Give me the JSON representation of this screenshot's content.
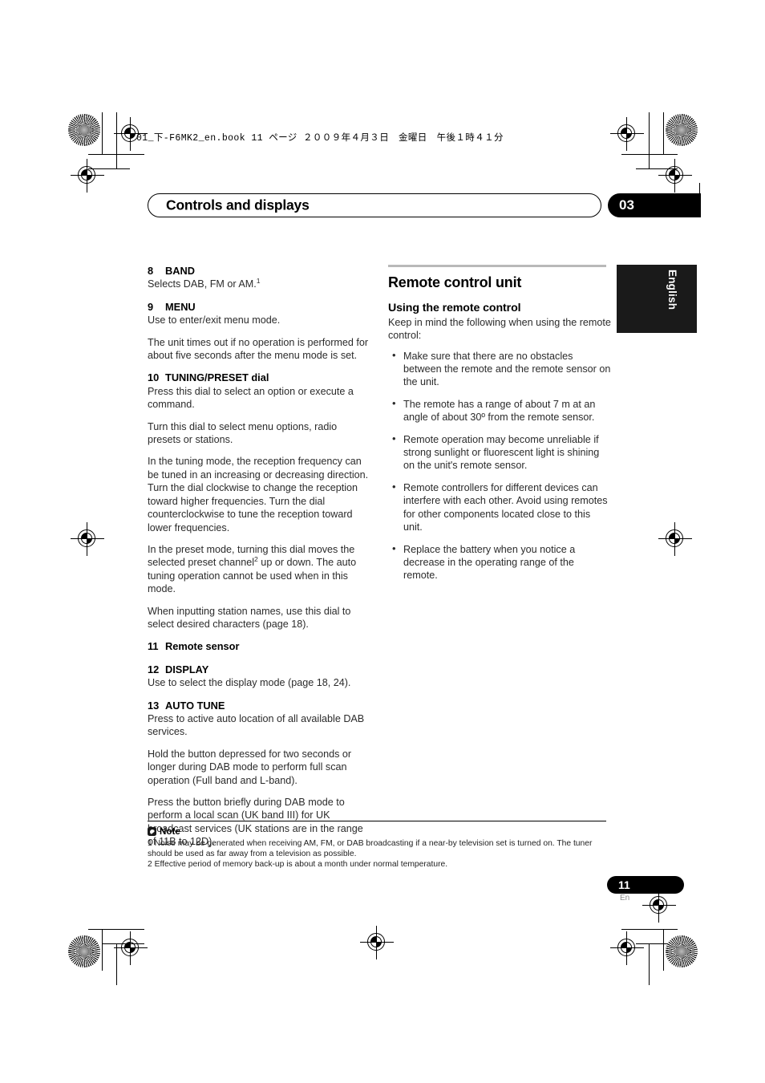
{
  "print_slug": "01_下-F6MK2_en.book  11 ページ  ２００９年４月３日　金曜日　午後１時４１分",
  "header": {
    "chapter_title": "Controls and displays",
    "chapter_number": "03",
    "language_tab": "English"
  },
  "left_column": {
    "entries": [
      {
        "num": "8",
        "title": "BAND",
        "paragraphs": [
          {
            "text": "Selects DAB, FM or AM.",
            "sup": "1"
          }
        ]
      },
      {
        "num": "9",
        "title": "MENU",
        "paragraphs": [
          {
            "text": "Use to enter/exit menu mode."
          },
          {
            "text": "The unit times out if no operation is performed for about five seconds after the menu mode is set."
          }
        ]
      },
      {
        "num": "10",
        "title": "TUNING/PRESET dial",
        "paragraphs": [
          {
            "text": "Press this dial to select an option or execute a command."
          },
          {
            "text": "Turn this dial to select menu options, radio presets or stations."
          },
          {
            "text": "In the tuning mode, the reception frequency can be tuned in an increasing or decreasing direction. Turn the dial clockwise to change the reception toward higher frequencies. Turn the dial counterclockwise to tune the reception toward lower frequencies."
          },
          {
            "text": "In the preset mode, turning this dial moves the selected preset channel",
            "sup": "2",
            "text_after": " up or down. The auto tuning operation cannot be used when in this mode."
          },
          {
            "text": "When inputting station names, use this dial to select desired characters (page 18)."
          }
        ]
      },
      {
        "num": "11",
        "title": "Remote sensor",
        "paragraphs": []
      },
      {
        "num": "12",
        "title": "DISPLAY",
        "paragraphs": [
          {
            "text": "Use to select the display mode (page 18, 24)."
          }
        ]
      },
      {
        "num": "13",
        "title": "AUTO TUNE",
        "paragraphs": [
          {
            "text": "Press to active auto location of all available DAB services."
          },
          {
            "text": "Hold the button depressed for two seconds or longer during DAB mode to perform full scan operation (Full band and L-band)."
          },
          {
            "text": "Press the button briefly during DAB mode to perform a local scan (UK band III) for UK broadcast services (UK stations are in the range of 11B to 12D)."
          }
        ]
      }
    ]
  },
  "right_column": {
    "section_title": "Remote control unit",
    "subsection_title": "Using the remote control",
    "intro": "Keep in mind the following when using the remote control:",
    "bullets": [
      "Make sure that there are no obstacles between the remote and the remote sensor on the unit.",
      "The remote has a range of about 7 m at an angle of about 30º from the remote sensor.",
      "Remote operation may become unreliable if strong sunlight or fluorescent light is shining on the unit's remote sensor.",
      "Remote controllers for different devices can interfere with each other. Avoid using remotes for other components located close to this unit.",
      "Replace the battery when you notice a decrease in the operating range of the remote."
    ]
  },
  "footer": {
    "note_label": "Note",
    "footnotes": [
      "1 Noise may be generated when receiving AM, FM, or DAB broadcasting if a near-by television set is turned on. The tuner should be used as far away from a television as possible.",
      "2 Effective period of memory back-up is about a month under normal temperature."
    ],
    "page_number": "11",
    "page_suffix": "En"
  }
}
